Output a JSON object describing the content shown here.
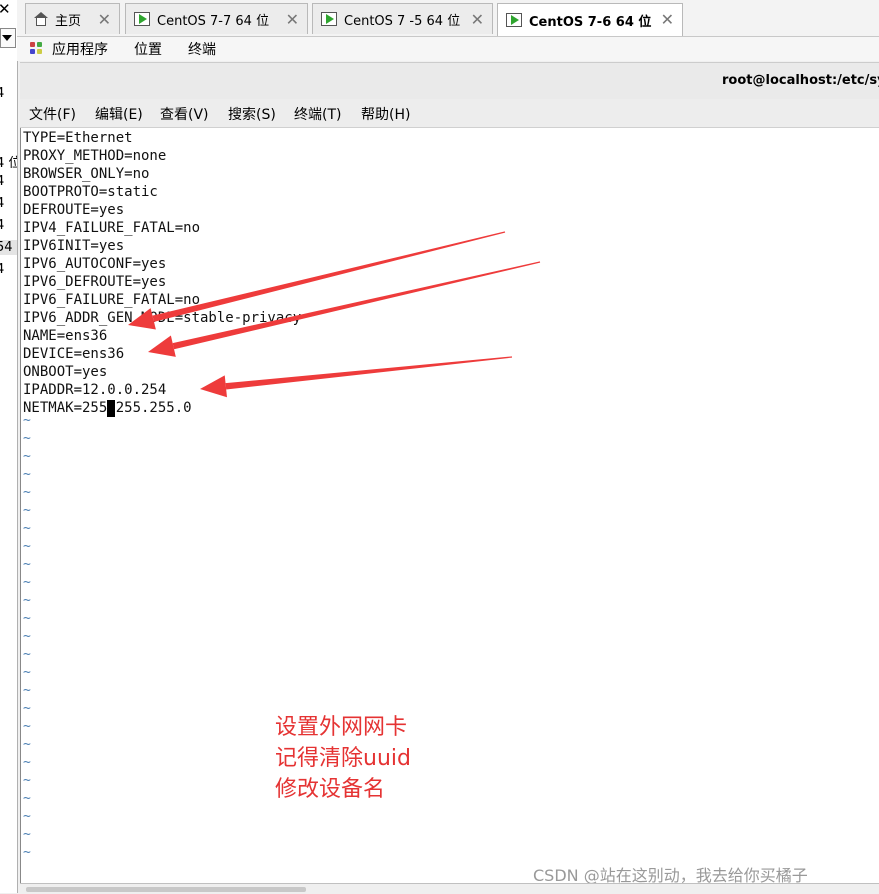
{
  "left_pane": {
    "close_glyph": "✕",
    "fragments": [
      "4",
      "4 位",
      "4",
      "4",
      "4",
      "54",
      "4"
    ]
  },
  "tabs": [
    {
      "label": "主页",
      "icon": "home-icon",
      "active": false
    },
    {
      "label": "CentOS 7-7  64 位",
      "icon": "vm-play-icon",
      "active": false
    },
    {
      "label": "CentOS 7 -5 64 位",
      "icon": "vm-play-icon",
      "active": false
    },
    {
      "label": "CentOS 7-6   64 位",
      "icon": "vm-play-icon",
      "active": true
    }
  ],
  "tab_close_glyph": "✕",
  "gnome_menu": [
    "应用程序",
    "位置",
    "终端"
  ],
  "window_title": "root@localhost:/etc/sys",
  "terminal_menu": [
    "文件(F)",
    "编辑(E)",
    "查看(V)",
    "搜索(S)",
    "终端(T)",
    "帮助(H)"
  ],
  "terminal_lines": [
    "TYPE=Ethernet",
    "PROXY_METHOD=none",
    "BROWSER_ONLY=no",
    "BOOTPROTO=static",
    "DEFROUTE=yes",
    "IPV4_FAILURE_FATAL=no",
    "IPV6INIT=yes",
    "IPV6_AUTOCONF=yes",
    "IPV6_DEFROUTE=yes",
    "IPV6_FAILURE_FATAL=no",
    "IPV6_ADDR_GEN_MODE=stable-privacy",
    "NAME=ens36",
    "DEVICE=ens36",
    "ONBOOT=yes",
    "IPADDR=12.0.0.254",
    "NETMAK=255.255.255.0"
  ],
  "tilde_char": "~",
  "tilde_count": 25,
  "annotation_lines": [
    "设置外网网卡",
    "记得清除uuid",
    "修改设备名"
  ],
  "watermark": "CSDN @站在这别动，我去给你买橘子",
  "colors": {
    "annotation": "#e53333",
    "arrow": "#ee3b3b",
    "vm_icon": "#2fa52f",
    "tilde": "#4a7fb3"
  }
}
